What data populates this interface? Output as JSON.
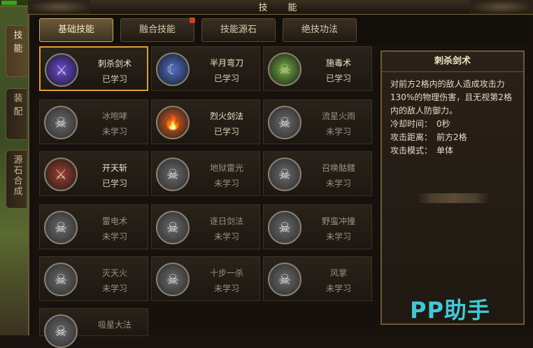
{
  "window": {
    "title": "技　能"
  },
  "side_tabs": [
    {
      "label": "技能",
      "active": true
    },
    {
      "label": "装配",
      "active": false
    },
    {
      "label": "源石合成",
      "active": false
    }
  ],
  "top_tabs": [
    {
      "label": "基础技能",
      "active": true
    },
    {
      "label": "融合技能",
      "active": false,
      "badge": true
    },
    {
      "label": "技能源石",
      "active": false
    },
    {
      "label": "绝技功法",
      "active": false
    }
  ],
  "skills": [
    {
      "name": "刺杀剑术",
      "status": "已学习",
      "icon": "sword-icon",
      "color": "#6a4ae0"
    },
    {
      "name": "半月弯刀",
      "status": "已学习",
      "icon": "crescent-blade-icon",
      "color": "#5070d0"
    },
    {
      "name": "施毒术",
      "status": "已学习",
      "icon": "poison-skull-icon",
      "color": "#70b040"
    },
    {
      "name": "冰咆哮",
      "status": "未学习",
      "icon": "locked-skull-icon",
      "color": "#6a6a6a"
    },
    {
      "name": "烈火剑法",
      "status": "已学习",
      "icon": "fire-sword-icon",
      "color": "#e06020"
    },
    {
      "name": "流星火雨",
      "status": "未学习",
      "icon": "locked-skull-icon",
      "color": "#6a6a6a"
    },
    {
      "name": "开天斩",
      "status": "已学习",
      "icon": "heaven-slash-icon",
      "color": "#a04030"
    },
    {
      "name": "地狱雷光",
      "status": "未学习",
      "icon": "locked-skull-icon",
      "color": "#6a6a6a"
    },
    {
      "name": "召唤骷髅",
      "status": "未学习",
      "icon": "locked-skull-icon",
      "color": "#6a6a6a"
    },
    {
      "name": "雷电术",
      "status": "未学习",
      "icon": "locked-skull-icon",
      "color": "#6a6a6a"
    },
    {
      "name": "逐日剑法",
      "status": "未学习",
      "icon": "locked-skull-icon",
      "color": "#6a6a6a"
    },
    {
      "name": "野蛮冲撞",
      "status": "未学习",
      "icon": "locked-skull-icon",
      "color": "#6a6a6a"
    },
    {
      "name": "灭天火",
      "status": "未学习",
      "icon": "locked-skull-icon",
      "color": "#6a6a6a"
    },
    {
      "name": "十步一杀",
      "status": "未学习",
      "icon": "locked-skull-icon",
      "color": "#6a6a6a"
    },
    {
      "name": "风掌",
      "status": "未学习",
      "icon": "locked-skull-icon",
      "color": "#6a6a6a"
    },
    {
      "name": "吸星大法",
      "status": "",
      "icon": "locked-skull-icon",
      "color": "#6a6a6a"
    }
  ],
  "detail": {
    "name": "刺杀剑术",
    "description": "对前方2格内的敌人造成攻击力130%的物理伤害，且无视第2格内的敌人防御力。",
    "rows": [
      {
        "label": "冷却时间：",
        "value": "0秒"
      },
      {
        "label": "攻击距离：",
        "value": "前方2格"
      },
      {
        "label": "攻击模式：",
        "value": "单体"
      }
    ]
  },
  "watermark": "PP助手"
}
